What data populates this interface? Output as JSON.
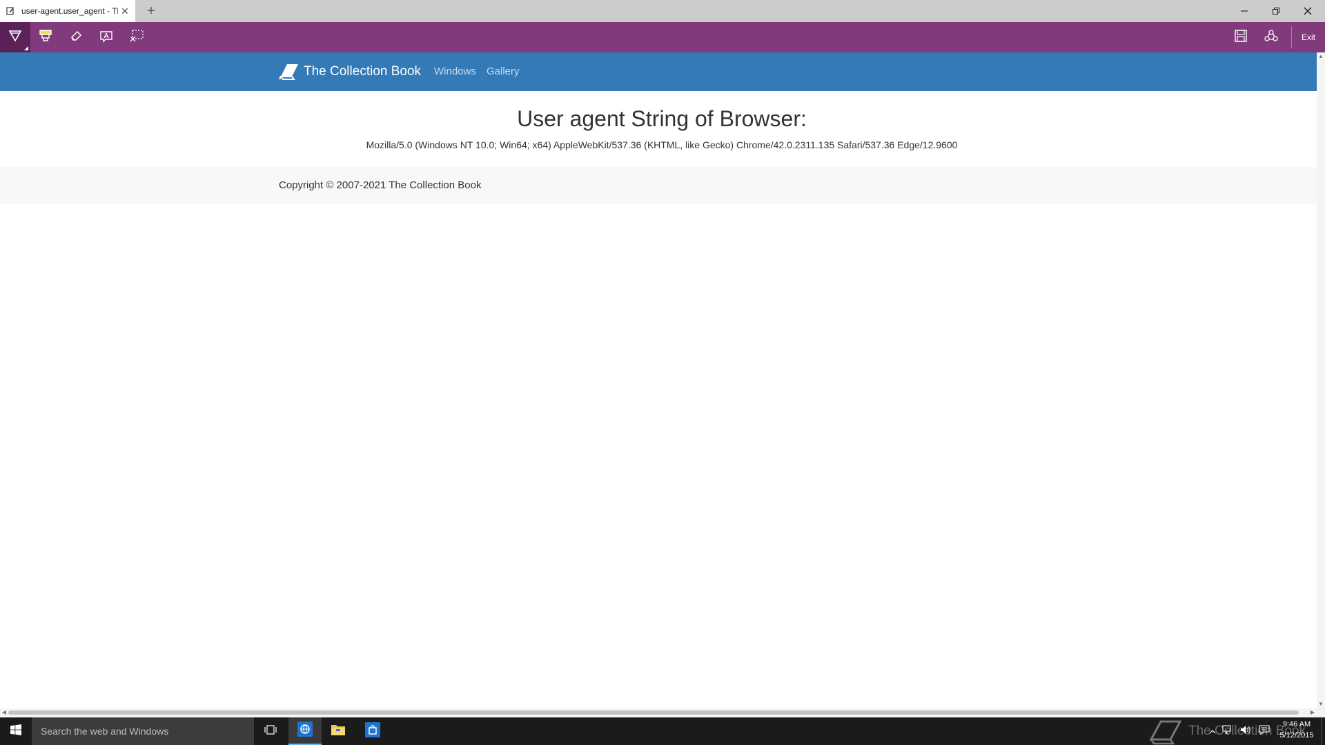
{
  "browser": {
    "tab_title": "user-agent.user_agent - Th",
    "new_tab_symbol": "+",
    "tab_close_symbol": "✕"
  },
  "window_controls": {
    "minimize": "—",
    "restore": "❐",
    "close": "✕"
  },
  "note_toolbar": {
    "exit_label": "Exit",
    "accent_color": "#813a7c",
    "tools": [
      "pen-icon",
      "highlighter-icon",
      "eraser-icon",
      "typed-note-icon",
      "clip-icon"
    ],
    "right_tools": [
      "save-icon",
      "share-icon"
    ]
  },
  "site": {
    "brand": "The Collection Book",
    "nav_links": [
      "Windows",
      "Gallery"
    ],
    "navbar_color": "#337ab7",
    "heading": "User agent String of Browser:",
    "user_agent": "Mozilla/5.0 (Windows NT 10.0; Win64; x64) AppleWebKit/537.36 (KHTML, like Gecko) Chrome/42.0.2311.135 Safari/537.36 Edge/12.9600",
    "copyright": "Copyright © 2007-2021 The Collection Book"
  },
  "taskbar": {
    "search_placeholder": "Search the web and Windows",
    "watermark": "The Collection Book",
    "time": "9:46 AM",
    "date": "5/12/2015",
    "apps": [
      "task-view-icon",
      "edge-browser-icon",
      "file-explorer-icon",
      "store-icon"
    ],
    "tray_icons": [
      "chevron-up-icon",
      "network-icon",
      "volume-icon",
      "action-center-icon"
    ]
  }
}
